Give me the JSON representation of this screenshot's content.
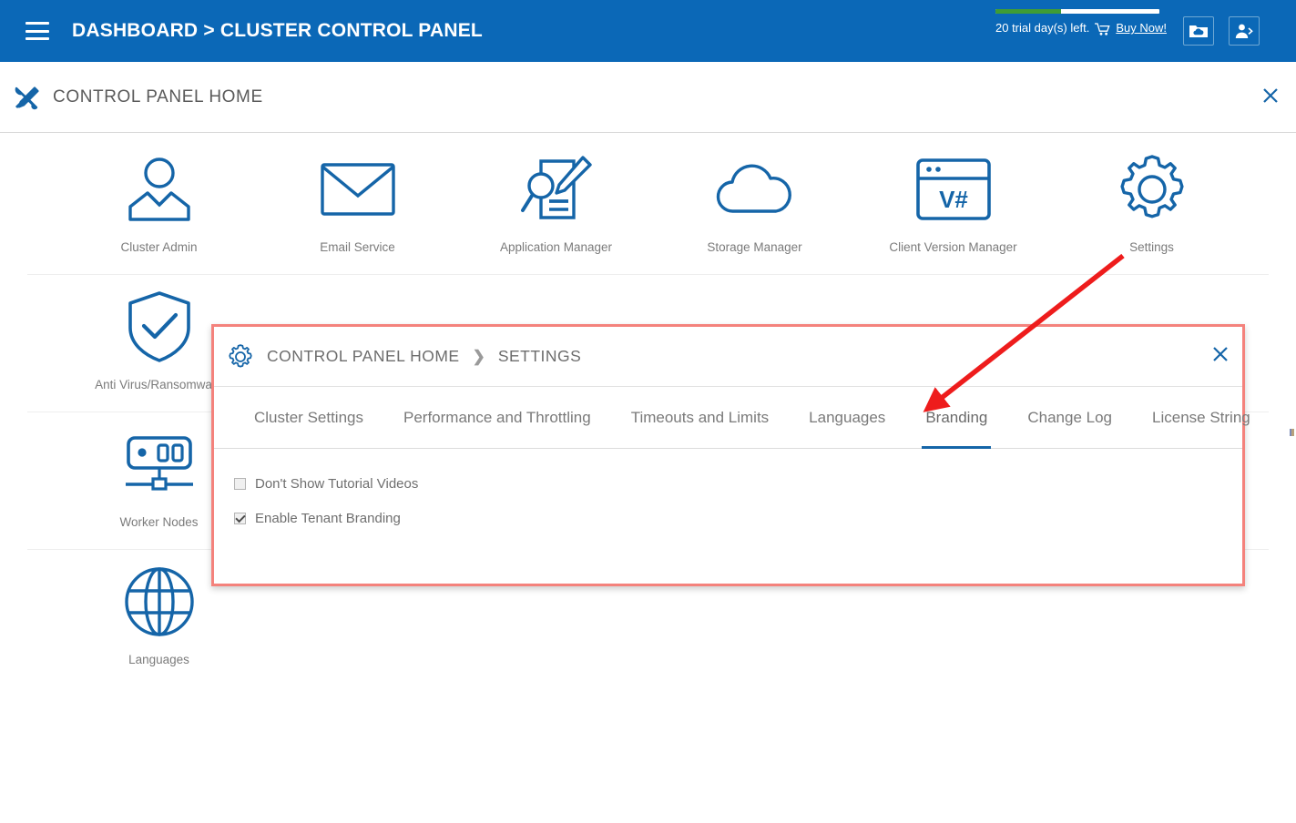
{
  "topbar": {
    "menu_icon": "hamburger-icon",
    "title": "DASHBOARD > CLUSTER CONTROL PANEL",
    "trial_text": "20 trial day(s) left.",
    "trial_percent": 40,
    "buy_now": "Buy Now!",
    "cart_icon": "cart-icon",
    "cloud_icon": "cloud-folder-icon",
    "user_icon": "user-logout-icon",
    "bar_color": "#3f9c35",
    "background": "#0b68b7"
  },
  "subheader": {
    "icon": "tools-icon",
    "title": "CONTROL PANEL HOME",
    "close_icon": "close-icon"
  },
  "grid": {
    "rows": [
      [
        {
          "label": "Cluster Admin",
          "icon": "user-admin-icon"
        },
        {
          "label": "Email Service",
          "icon": "envelope-icon"
        },
        {
          "label": "Application Manager",
          "icon": "document-search-edit-icon"
        },
        {
          "label": "Storage Manager",
          "icon": "cloud-icon"
        },
        {
          "label": "Client Version Manager",
          "icon": "browser-window-vhash-icon"
        },
        {
          "label": "Settings",
          "icon": "gear-icon"
        }
      ],
      [
        {
          "label": "Anti Virus/Ransomware",
          "icon": "shield-check-icon"
        }
      ],
      [
        {
          "label": "Worker Nodes",
          "icon": "server-node-icon"
        }
      ],
      [
        {
          "label": "Languages",
          "icon": "globe-icon"
        }
      ]
    ]
  },
  "overlay": {
    "icon": "gear-icon",
    "breadcrumb_home": "CONTROL PANEL HOME",
    "breadcrumb_sep": "❯",
    "breadcrumb_current": "SETTINGS",
    "close_icon": "close-icon",
    "tabs": [
      {
        "label": "Cluster Settings",
        "active": false
      },
      {
        "label": "Performance and Throttling",
        "active": false
      },
      {
        "label": "Timeouts and Limits",
        "active": false
      },
      {
        "label": "Languages",
        "active": false
      },
      {
        "label": "Branding",
        "active": true
      },
      {
        "label": "Change Log",
        "active": false
      },
      {
        "label": "License String",
        "active": false
      }
    ],
    "checkboxes": [
      {
        "label": "Don't Show Tutorial Videos",
        "checked": false
      },
      {
        "label": "Enable Tenant Branding",
        "checked": true
      }
    ],
    "border_color": "#f4827c",
    "active_tab_color": "#1565a8"
  },
  "annotation": {
    "arrow_color": "#ee1c1c",
    "from": "settings-gear-tile",
    "to": "branding-tab"
  }
}
